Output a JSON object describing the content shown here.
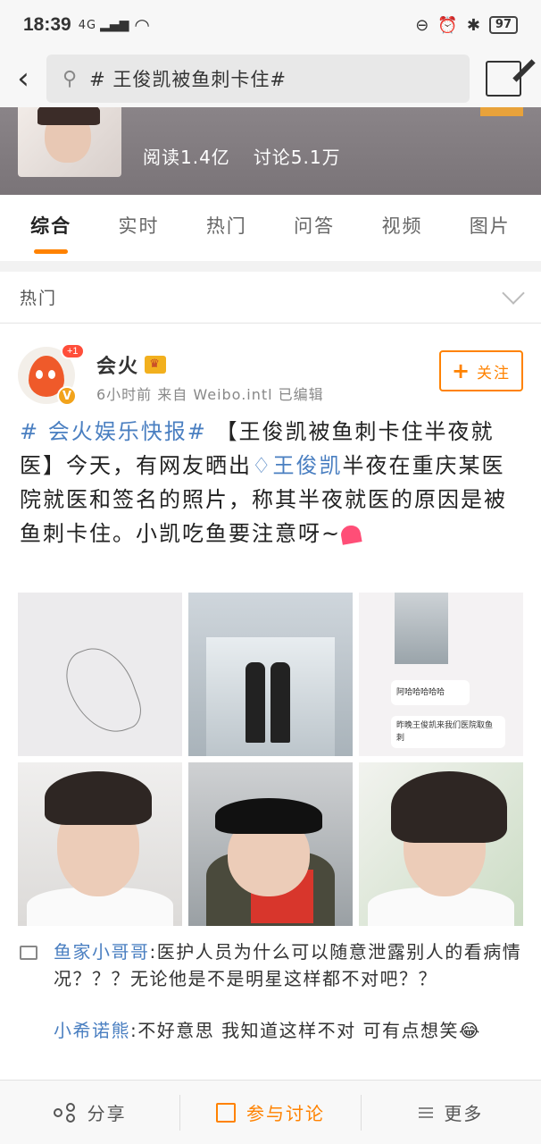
{
  "status_bar": {
    "time": "18:39",
    "network": "4G",
    "battery": "97"
  },
  "search": {
    "query": "# 王俊凯被鱼刺卡住#"
  },
  "topic": {
    "reads": "阅读1.4亿",
    "discussions": "讨论5.1万"
  },
  "tabs": [
    "综合",
    "实时",
    "热门",
    "问答",
    "视频",
    "图片"
  ],
  "section": {
    "label": "热门"
  },
  "post": {
    "author": "会火",
    "notification_badge": "+1",
    "verified_badge": "V",
    "meta": "6小时前  来自 Weibo.intl  已编辑",
    "follow_label": "关注",
    "hashtag": "# 会火娱乐快报#",
    "text_part1": " 【王俊凯被鱼刺卡住半夜就医】今天，有网友晒出",
    "mention": "王俊凯",
    "text_part2": "半夜在重庆某医院就医和签名的照片，称其半夜就医的原因是被鱼刺卡住。小凯吃鱼要注意呀~",
    "images": {
      "chat_line1": "阿哈哈哈哈哈",
      "chat_line2": "昨晚王俊凯来我们医院取鱼刺"
    }
  },
  "comments": [
    {
      "author": "鱼家小哥哥",
      "text": ":医护人员为什么可以随意泄露别人的看病情况？？？无论他是不是明星这样都不对吧？？"
    },
    {
      "author": "小希诺熊",
      "text": ":不好意思 我知道这样不对 可有点想笑"
    }
  ],
  "bottom_bar": {
    "share": "分享",
    "discuss": "参与讨论",
    "more": "更多"
  },
  "colors": {
    "accent": "#ff8200",
    "link": "#4a7fc1"
  }
}
